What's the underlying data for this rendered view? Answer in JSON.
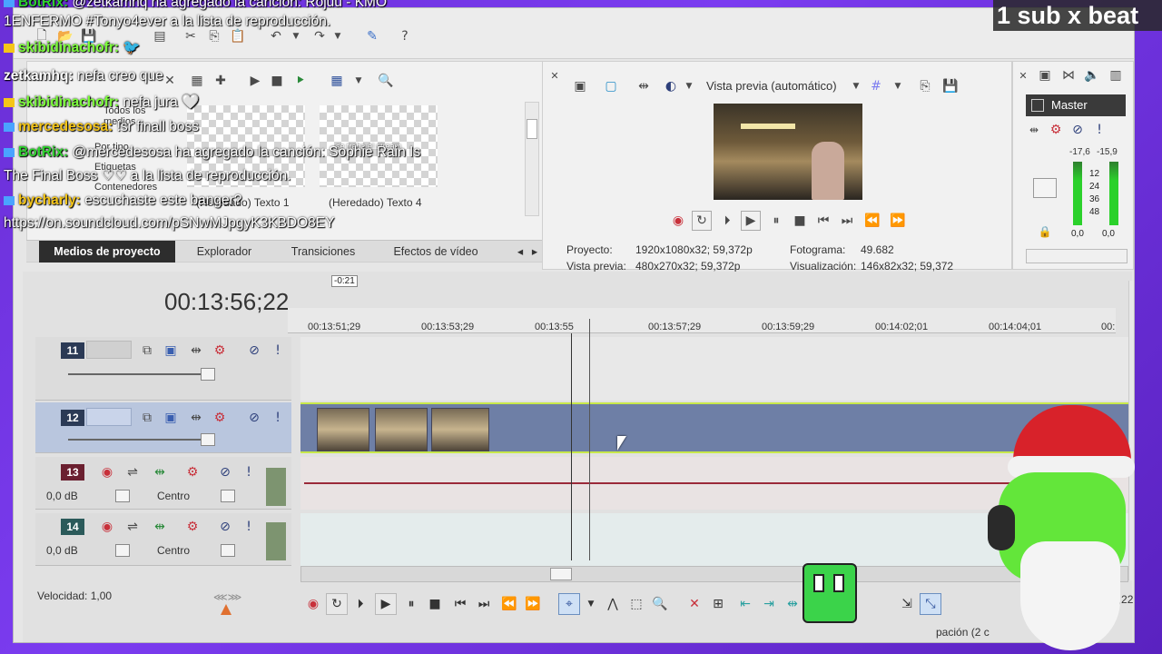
{
  "overlay": {
    "tag": "1 sub x beat"
  },
  "chat": [
    {
      "user": "BotRix:",
      "text": " @zetkamhq ha agregado la canción: Rojuu - KMO",
      "color": "#2fd12f",
      "badge": "#4aa3ff"
    },
    {
      "user": "",
      "text": "1ENFERMO #Tonyo4ever a la lista de reproducción.",
      "color": "#fff",
      "badge": ""
    },
    {
      "user": "skibidinachofr:",
      "text": " 🐦",
      "color": "#7cff3a",
      "badge": "#f5c518"
    },
    {
      "user": "zetkamhq:",
      "text": " nefa creo que",
      "color": "#ffffff",
      "badge": ""
    },
    {
      "user": "skibidinachofr:",
      "text": " nefa jura 🤍",
      "color": "#7cff3a",
      "badge": "#f5c518"
    },
    {
      "user": "mercedesosa:",
      "text": " !sr finall boss",
      "color": "#f5c518",
      "badge": "#4aa3ff"
    },
    {
      "user": "BotRix:",
      "text": " @mercedesosa ha agregado la canción: Sophie Rain Is",
      "color": "#2fd12f",
      "badge": "#4aa3ff"
    },
    {
      "user": "",
      "text": "The Final Boss ♡♡ a la lista de reproducción.",
      "color": "#fff",
      "badge": ""
    },
    {
      "user": "bycharly:",
      "text": " escuchaste este banger?",
      "color": "#f5c518",
      "badge": "#4aa3ff"
    },
    {
      "user": "",
      "text": "https://on.soundcloud.com/pSNwMJpgyK3KBDO8EY",
      "color": "#fff",
      "badge": ""
    }
  ],
  "media_panel": {
    "tree": [
      "Todos los medios",
      "Por tipo",
      "Etiquetas",
      "Contenedores"
    ],
    "thumbs": [
      {
        "label": "(Heredado) Texto 1",
        "caption": ""
      },
      {
        "label": "(Heredado) Texto 4",
        "caption": "se traba el stream"
      }
    ],
    "tabs": [
      "Medios de proyecto",
      "Explorador",
      "Transiciones",
      "Efectos de vídeo"
    ]
  },
  "preview": {
    "mode": "Vista previa (automático)",
    "proyecto_label": "Proyecto:",
    "proyecto_value": "1920x1080x32; 59,372p",
    "vista_label": "Vista previa:",
    "vista_value": "480x270x32; 59,372p",
    "fotograma_label": "Fotograma:",
    "fotograma_value": "49.682",
    "visual_label": "Visualización:",
    "visual_value": "146x82x32; 59,372"
  },
  "master": {
    "label": "Master",
    "left_db": "-17,6",
    "right_db": "-15,9",
    "scale": [
      "12",
      "24",
      "36",
      "48"
    ],
    "left_level": "0,0",
    "right_level": "0,0"
  },
  "timeline": {
    "timecode": "00:13:56;22",
    "cursor_offset": "-0:21",
    "ruler": [
      "00:13:51;29",
      "00:13:53;29",
      "00:13:55",
      "00:13:57;29",
      "00:13:59;29",
      "00:14:02;01",
      "00:14:04;01",
      "00:"
    ],
    "tracks": [
      {
        "number": "11",
        "type": "video"
      },
      {
        "number": "12",
        "type": "video"
      },
      {
        "number": "13",
        "type": "audio",
        "db": "0,0 dB",
        "pan": "Centro"
      },
      {
        "number": "14",
        "type": "audio",
        "db": "0,0 dB",
        "pan": "Centro"
      }
    ],
    "speed_label": "Velocidad: 1,00",
    "bottom_timecode": "00:13:56;22",
    "status_fragment": "pación (2 c"
  }
}
